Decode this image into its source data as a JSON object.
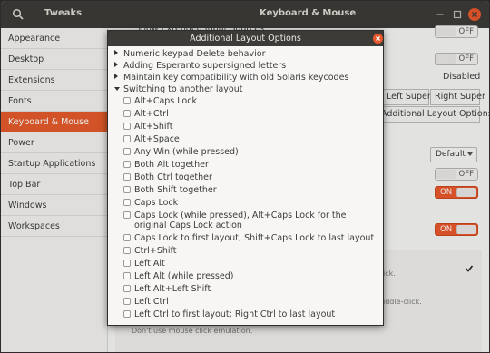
{
  "window": {
    "app_name": "Tweaks",
    "title": "Keyboard & Mouse"
  },
  "sidebar": {
    "items": [
      {
        "label": "Appearance",
        "active": false
      },
      {
        "label": "Desktop",
        "active": false
      },
      {
        "label": "Extensions",
        "active": false
      },
      {
        "label": "Fonts",
        "active": false
      },
      {
        "label": "Keyboard & Mouse",
        "active": true
      },
      {
        "label": "Power",
        "active": false
      },
      {
        "label": "Startup Applications",
        "active": false
      },
      {
        "label": "Top Bar",
        "active": false
      },
      {
        "label": "Windows",
        "active": false
      },
      {
        "label": "Workspaces",
        "active": false
      }
    ]
  },
  "content": {
    "partial_heading": "Show Extended Input Sources",
    "toggle1": "OFF",
    "toggle2": "OFF",
    "disabled_label": "Disabled",
    "left_super": "Left Super",
    "right_super": "Right Super",
    "additional_layout_button": "Additional Layout Options",
    "default_combo": "Default",
    "toggle3": "OFF",
    "toggle4": "ON",
    "toggle5": "ON",
    "panel_text1": "ick.",
    "panel_text2": "iddle-click.",
    "panel_footer": "Don't use mouse click emulation."
  },
  "dialog": {
    "title": "Additional Layout Options",
    "collapsed_sections": [
      "Numeric keypad Delete behavior",
      "Adding Esperanto supersigned letters",
      "Maintain key compatibility with old Solaris keycodes"
    ],
    "expanded_section": "Switching to another layout",
    "options": [
      "Alt+Caps Lock",
      "Alt+Ctrl",
      "Alt+Shift",
      "Alt+Space",
      "Any Win (while pressed)",
      "Both Alt together",
      "Both Ctrl together",
      "Both Shift together",
      "Caps Lock",
      "Caps Lock (while pressed), Alt+Caps Lock for the original Caps Lock action",
      "Caps Lock to first layout; Shift+Caps Lock to last layout",
      "Ctrl+Shift",
      "Left Alt",
      "Left Alt (while pressed)",
      "Left Alt+Left Shift",
      "Left Ctrl",
      "Left Ctrl to first layout; Right Ctrl to last layout"
    ]
  },
  "colors": {
    "accent": "#e9582c",
    "titlebar": "#3c3b37",
    "sidebar_active": "#e45b2b"
  },
  "icons": {
    "search": "search-icon",
    "minimize": "minimize-icon",
    "maximize": "maximize-icon",
    "close": "close-icon",
    "checkmark": "checkmark-icon"
  }
}
